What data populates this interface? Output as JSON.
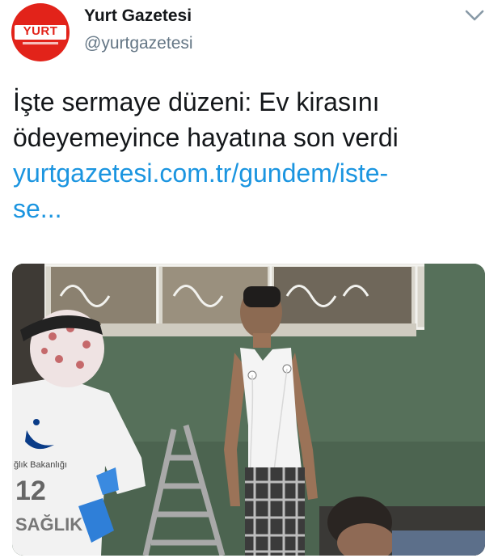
{
  "tweet": {
    "display_name": "Yurt Gazetesi",
    "handle": "@yurtgazetesi",
    "avatar_text": "YURT",
    "text_lines": [
      "İşte sermaye düzeni: Ev kirasını",
      "ödeyemeyince hayatına son verdi"
    ],
    "link_lines": [
      "yurtgazetesi.com.tr/gundem/iste-",
      "se..."
    ]
  },
  "media": {
    "vest_badge_text": "ğlık Bakanlığı",
    "vest_number": "12",
    "vest_label": "SAĞLIK"
  },
  "icons": {
    "menu": "chevron-down-icon"
  },
  "colors": {
    "brand_red": "#e2231a",
    "link_blue": "#1b95e0",
    "text_dark": "#14171a",
    "text_gray": "#657786"
  }
}
